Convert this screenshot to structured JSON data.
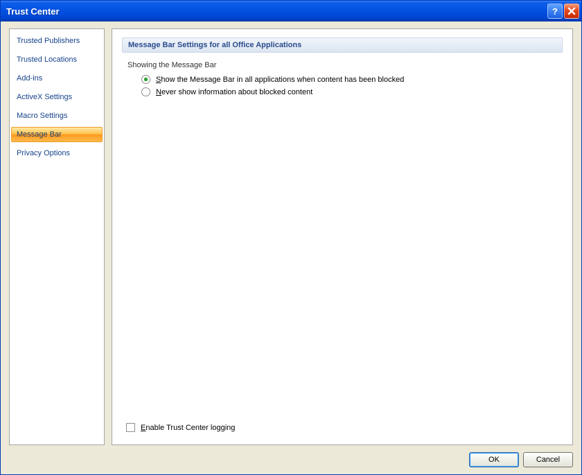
{
  "window": {
    "title": "Trust Center"
  },
  "sidebar": {
    "items": [
      {
        "label": "Trusted Publishers",
        "selected": false
      },
      {
        "label": "Trusted Locations",
        "selected": false
      },
      {
        "label": "Add-ins",
        "selected": false
      },
      {
        "label": "ActiveX Settings",
        "selected": false
      },
      {
        "label": "Macro Settings",
        "selected": false
      },
      {
        "label": "Message Bar",
        "selected": true
      },
      {
        "label": "Privacy Options",
        "selected": false
      }
    ]
  },
  "main": {
    "section_header": "Message Bar Settings for all Office Applications",
    "group_title": "Showing the Message Bar",
    "options": [
      {
        "label": "Show the Message Bar in all applications when content has been blocked",
        "checked": true
      },
      {
        "label": "Never show information about blocked content",
        "checked": false
      }
    ],
    "logging_checkbox": {
      "label": "Enable Trust Center logging",
      "checked": false
    }
  },
  "buttons": {
    "ok": "OK",
    "cancel": "Cancel"
  }
}
